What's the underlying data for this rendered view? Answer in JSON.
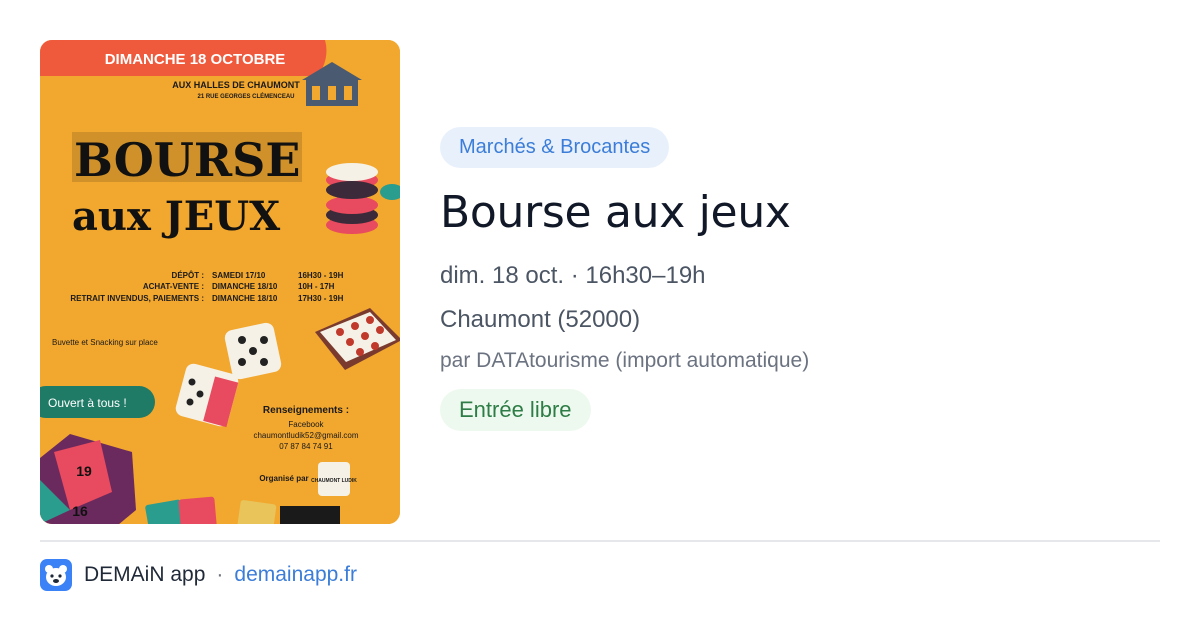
{
  "poster": {
    "date_banner": "DIMANCHE 18 OCTOBRE",
    "venue_line1": "AUX HALLES DE CHAUMONT",
    "venue_line2": "21 RUE GEORGES CLÉMENCEAU",
    "title_line1": "BOURSE",
    "title_line2": "aux JEUX",
    "schedule": [
      {
        "label": "DÉPÔT :",
        "day": "SAMEDI 17/10",
        "time": "16H30 - 19H"
      },
      {
        "label": "ACHAT-VENTE :",
        "day": "DIMANCHE 18/10",
        "time": "10H - 17H"
      },
      {
        "label": "RETRAIT INVENDUS, PAIEMENTS :",
        "day": "DIMANCHE 18/10",
        "time": "17H30 - 19H"
      }
    ],
    "buvette": "Buvette et Snacking sur place",
    "open_badge": "Ouvert à tous !",
    "info_heading": "Renseignements :",
    "info_line1": "Facebook",
    "info_line2": "chaumontludik52@gmail.com",
    "info_line3": "07 87 84 74 91",
    "organized_by": "Organisé par",
    "organizer_logo_text": "CHAUMONT LUDIK",
    "dice_numbers": [
      "19",
      "16"
    ],
    "colors": {
      "background": "#f2a72e",
      "banner": "#ef5a3c",
      "badge": "#1f7a66"
    }
  },
  "event": {
    "category": "Marchés & Brocantes",
    "title": "Bourse aux jeux",
    "datetime": "dim. 18 oct. · 16h30–19h",
    "location": "Chaumont (52000)",
    "organizer": "par DATAtourisme (import automatique)",
    "price": "Entrée libre"
  },
  "footer": {
    "app_name": "DEMAiN app",
    "separator": "·",
    "domain": "demainapp.fr",
    "logo_icon": "bear-icon"
  },
  "colors": {
    "accent": "#3b7dd8",
    "category_bg": "#e8f1fb",
    "price_text": "#2e7d46",
    "price_bg": "#edf9ef"
  }
}
